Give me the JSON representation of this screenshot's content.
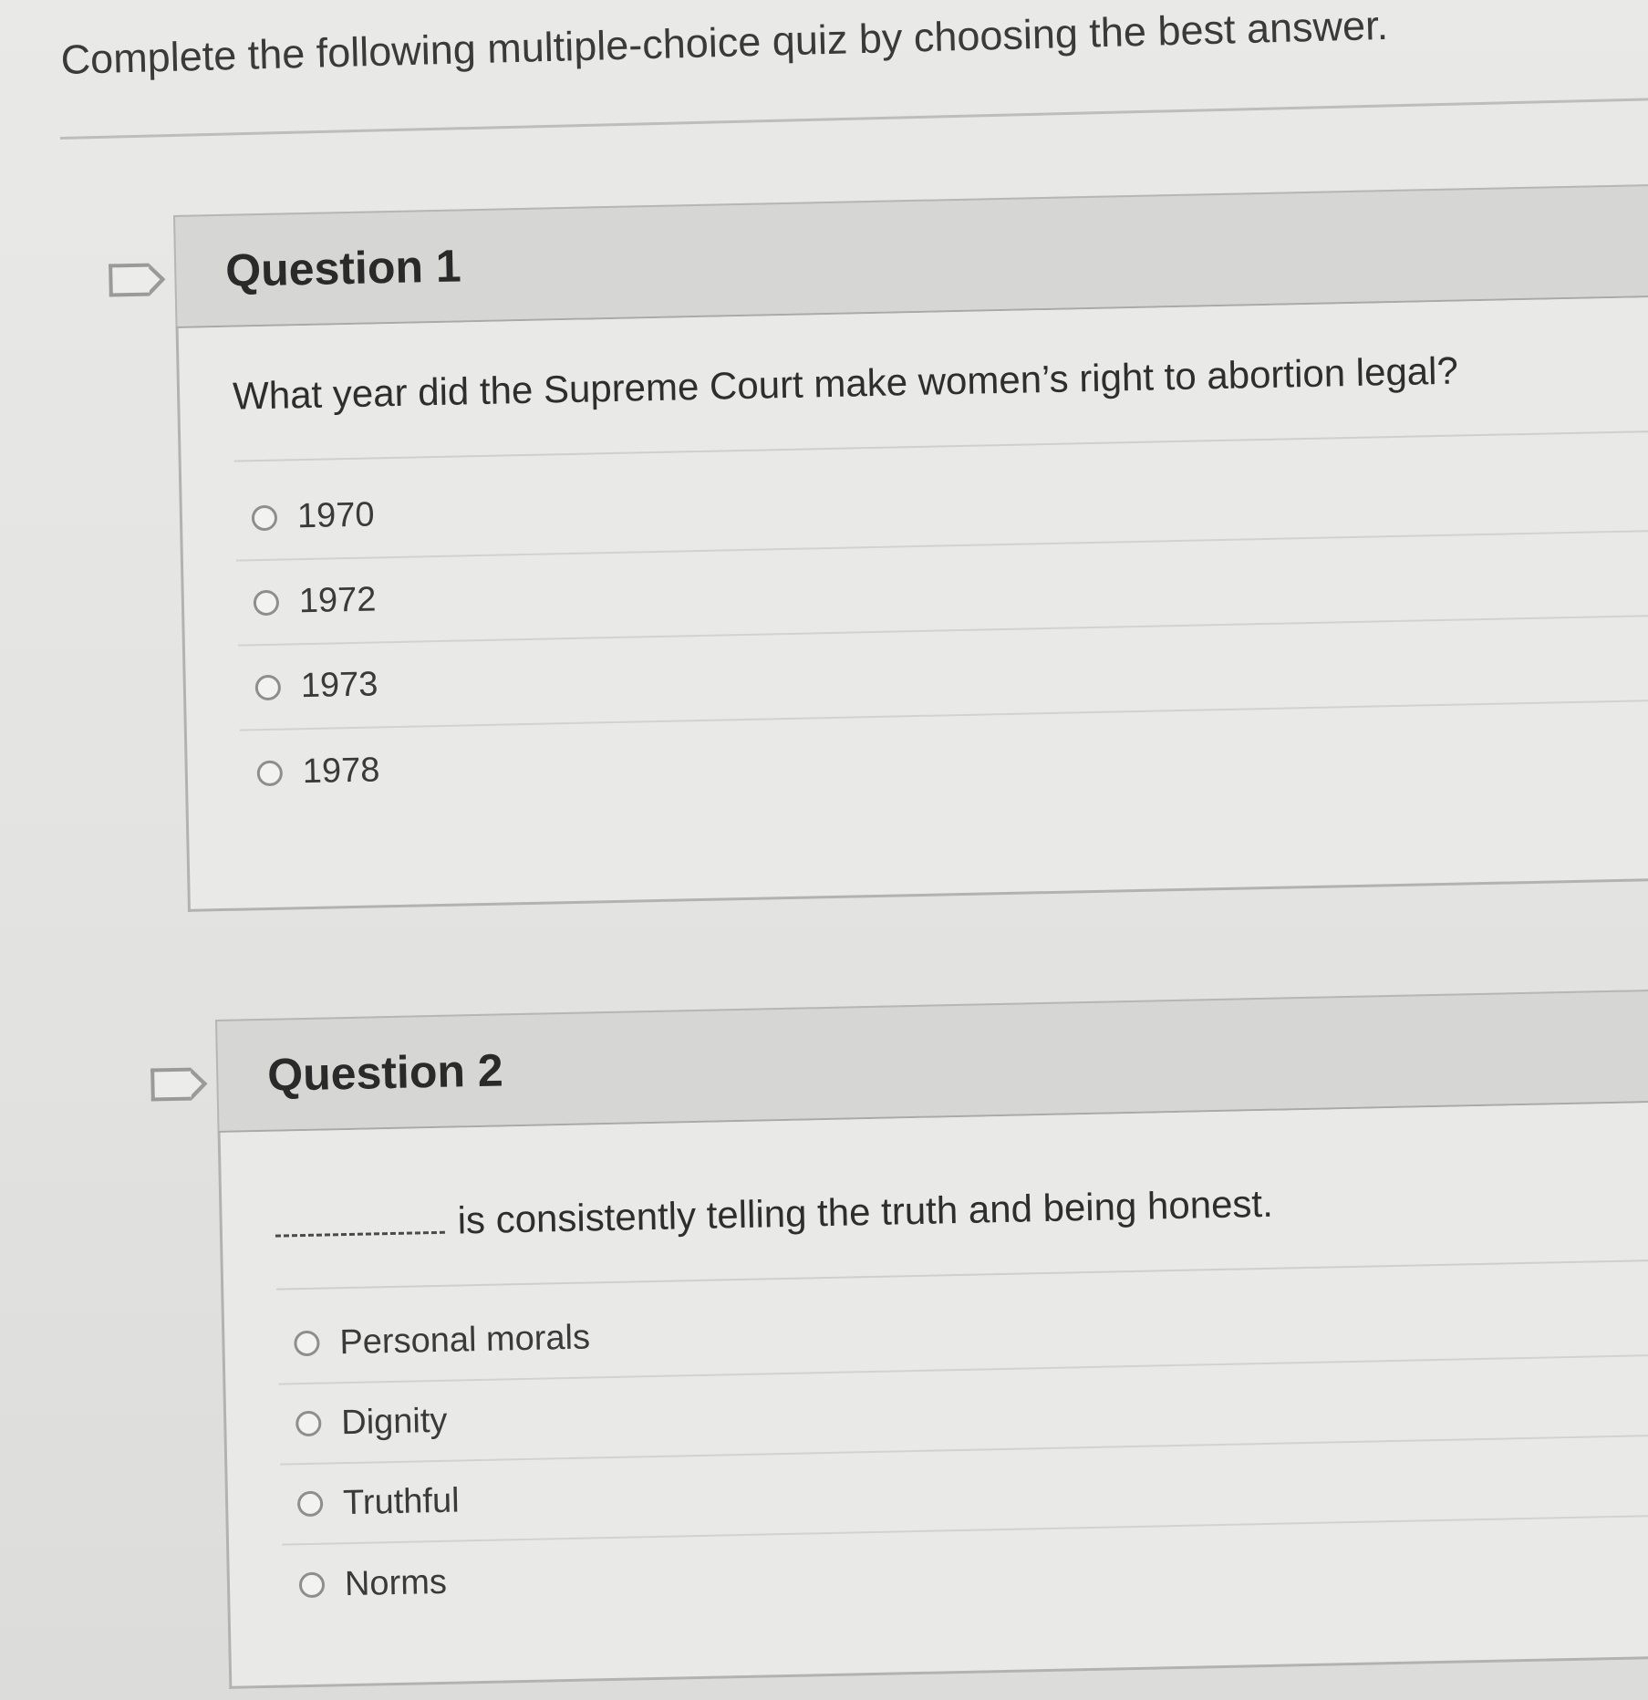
{
  "instructions": "Complete the following multiple-choice quiz by choosing the best answer.",
  "questions": [
    {
      "title": "Question 1",
      "text": "What year did the Supreme Court make women’s right to abortion legal?",
      "options": [
        "1970",
        "1972",
        "1973",
        "1978"
      ]
    },
    {
      "title": "Question 2",
      "text_after_blank": "is consistently telling the truth and being honest.",
      "options": [
        "Personal morals",
        "Dignity",
        "Truthful",
        "Norms"
      ]
    }
  ],
  "icons": {
    "flag": "flag-icon",
    "radio": "radio-button-icon"
  }
}
